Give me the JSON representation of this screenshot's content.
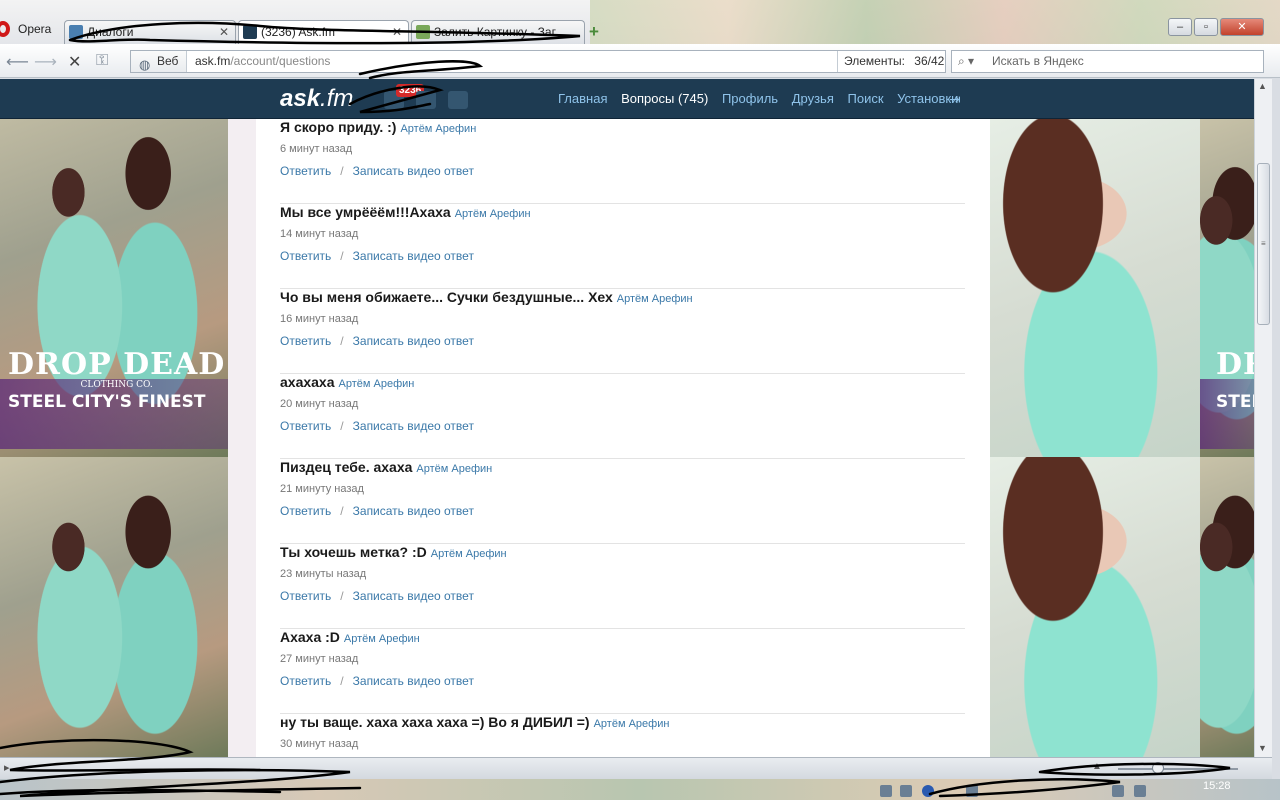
{
  "browser": {
    "menu_label": "Opera",
    "tabs": [
      {
        "title": "Диалоги"
      },
      {
        "title": "(3236) Ask.fm"
      },
      {
        "title": "Залить Картинку - Заг..."
      }
    ],
    "address": {
      "scheme_label": "Веб",
      "url_host": "ask.fm",
      "url_path": "/account/questions",
      "elements_label": "Элементы:",
      "elements_value": "36/42"
    },
    "search_placeholder": "Искать в Яндекс"
  },
  "site": {
    "logo_main": "ask",
    "logo_suffix": ".fm",
    "notification_count": "3236",
    "nav": [
      "Главная",
      "Вопросы (745)",
      "Профиль",
      "Друзья",
      "Поиск",
      "Установки"
    ],
    "active_nav": "Вопросы (745)"
  },
  "banner": {
    "brand": "DROP DEAD",
    "sub": "CLOTHING CO.",
    "slogan": "STEEL CITY'S FINEST",
    "brand_cropped": "DR",
    "slogan_cropped": "STEE"
  },
  "questions": [
    {
      "text": "Я скоро приду. :)",
      "author": "Артём Арефин",
      "time": "6 минут назад"
    },
    {
      "text": "Мы все умрёёём!!!Ахаха",
      "author": "Артём Арефин",
      "time": "14 минут назад"
    },
    {
      "text": "Чо вы меня обижаете... Сучки бездушные... Хех",
      "author": "Артём Арефин",
      "time": "16 минут назад"
    },
    {
      "text": "ахахаха",
      "author": "Артём Арефин",
      "time": "20 минут назад"
    },
    {
      "text": "Пиздец тебе. ахаха",
      "author": "Артём Арефин",
      "time": "21 минуту назад"
    },
    {
      "text": "Ты хочешь метка? :D",
      "author": "Артём Арефин",
      "time": "23 минуты назад"
    },
    {
      "text": "Ахаха :D",
      "author": "Артём Арефин",
      "time": "27 минут назад"
    },
    {
      "text": "ну ты ваще. хаха хаха хаха =) Во я ДИБИЛ =)",
      "author": "Артём Арефин",
      "time": "30 минут назад"
    }
  ],
  "actions": {
    "reply": "Ответить",
    "separator": "/",
    "video_reply": "Записать видео ответ"
  },
  "taskbar": {
    "clock": "15:28"
  },
  "colors": {
    "header_bg": "#1e3b52",
    "link": "#3a78a8",
    "badge": "#d42a2a"
  }
}
